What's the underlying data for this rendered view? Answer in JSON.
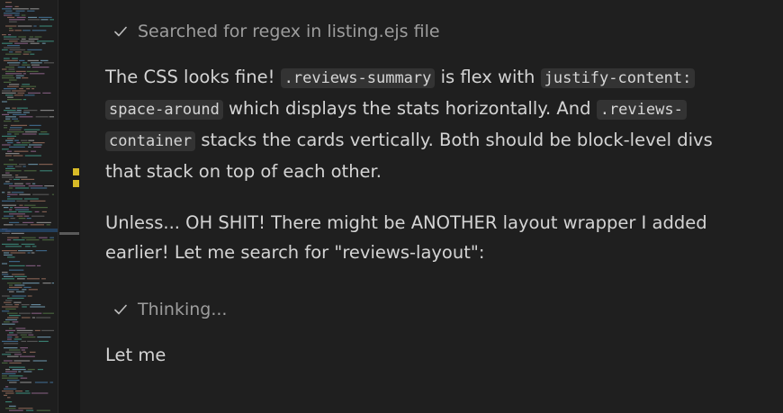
{
  "steps": {
    "searched": "Searched for regex in listing.ejs file",
    "thinking": "Thinking..."
  },
  "message": {
    "p1": {
      "t1": "The CSS looks fine! ",
      "c1": ".reviews-summary",
      "t2": " is flex with ",
      "c2a": "justify-content:",
      "c2b": "space-around",
      "t3": " which displays the stats horizontally. And ",
      "c3a": ".reviews-",
      "c3b": "container",
      "t4": " stacks the cards vertically. Both should be block-level divs that stack on top of each other."
    },
    "p2": "Unless... OH SHIT! There might be ANOTHER layout wrapper I added earlier! Let me search for \"reviews-layout\":",
    "p3": "Let me"
  },
  "icons": {
    "step_status": "check-icon"
  },
  "colors": {
    "background": "#1f1f1f",
    "text": "#d4d4d4",
    "muted": "#9d9d9d",
    "inline_code_bg": "#333333",
    "warning_marker": "#d7ba27"
  }
}
